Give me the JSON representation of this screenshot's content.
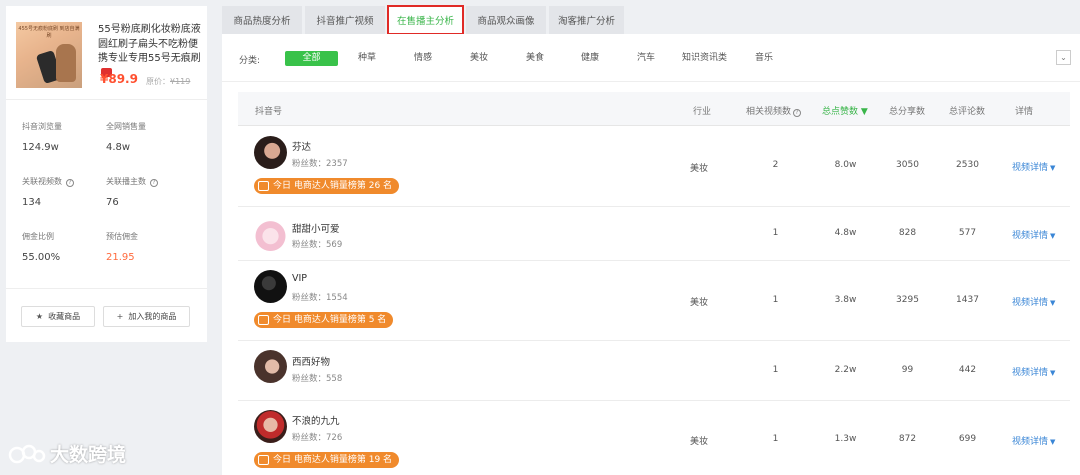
{
  "product": {
    "thumb_caption": "455号无痕粉底刷 到店自满刷",
    "title": "55号粉底刷化妆粉底液圆红刷子扁头不吃粉便携专业专用55号无痕刷",
    "price": "¥89.9",
    "orig_label": "原价：",
    "orig_price": "¥119"
  },
  "stats": [
    {
      "label": "抖音浏览量",
      "value": "124.9w"
    },
    {
      "label": "全网销售量",
      "value": "4.8w"
    },
    {
      "label": "关联视频数",
      "value": "134"
    },
    {
      "label": "关联播主数",
      "value": "76"
    },
    {
      "label": "佣金比例",
      "value": "55.00%"
    },
    {
      "label": "预估佣金",
      "value": "21.95"
    }
  ],
  "help_glyph": "?",
  "buttons": {
    "favorite": "收藏商品",
    "favorite_icon": "★",
    "add": "加入我的商品",
    "add_icon": "+"
  },
  "tabs": [
    "商品热度分析",
    "抖音推广视频",
    "在售播主分析",
    "商品观众画像",
    "淘客推广分析"
  ],
  "active_tab": 2,
  "filter": {
    "label": "分类:",
    "items": [
      "全部",
      "种草",
      "情感",
      "美妆",
      "美食",
      "健康",
      "汽车",
      "知识资讯类",
      "音乐"
    ],
    "toggle_icon": "⌄"
  },
  "table": {
    "headers": [
      "抖音号",
      "行业",
      "相关视频数",
      "总点赞数 ▼",
      "总分享数",
      "总评论数",
      "详情"
    ],
    "detail_label": "视频详情",
    "detail_caret": "▼",
    "rows": [
      {
        "name": "芬达",
        "fans": "粉丝数：2357",
        "industry": "美妆",
        "videos": "2",
        "likes": "8.0w",
        "shares": "3050",
        "comments": "2530",
        "badge": "今日 电商达人销量榜第 26 名"
      },
      {
        "name": "甜甜小可爱",
        "fans": "粉丝数：569",
        "industry": "",
        "videos": "1",
        "likes": "4.8w",
        "shares": "828",
        "comments": "577",
        "badge": ""
      },
      {
        "name": "VIP",
        "fans": "粉丝数：1554",
        "industry": "美妆",
        "videos": "1",
        "likes": "3.8w",
        "shares": "3295",
        "comments": "1437",
        "badge": "今日 电商达人销量榜第 5 名"
      },
      {
        "name": "西西好物",
        "fans": "粉丝数：558",
        "industry": "",
        "videos": "1",
        "likes": "2.2w",
        "shares": "99",
        "comments": "442",
        "badge": ""
      },
      {
        "name": "不浪的九九",
        "fans": "粉丝数：726",
        "industry": "美妆",
        "videos": "1",
        "likes": "1.3w",
        "shares": "872",
        "comments": "699",
        "badge": "今日 电商达人销量榜第 19 名"
      }
    ]
  },
  "watermark": "大数跨境",
  "colors": {
    "accent_green": "#3ab54a",
    "price_orange": "#ff5030",
    "badge_orange": "#f08a2c",
    "link_blue": "#3a86d6",
    "highlight_red": "#e02a26"
  }
}
